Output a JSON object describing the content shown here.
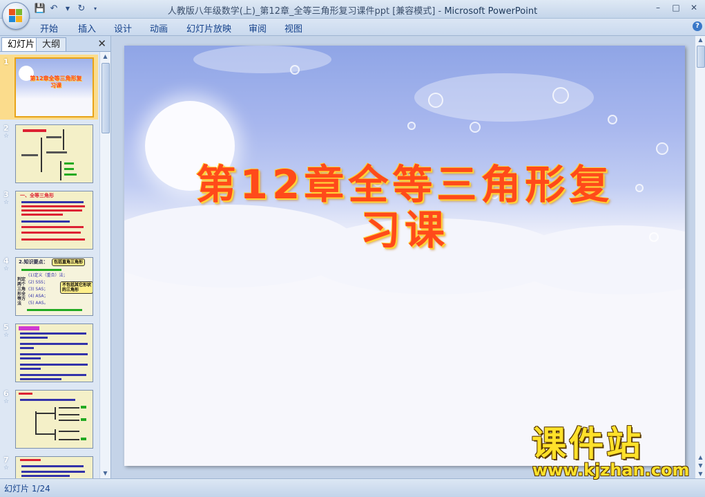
{
  "window": {
    "title": "人教版八年级数学(上)_第12章_全等三角形复习课件ppt [兼容模式]",
    "separator": " - ",
    "app_name": "Microsoft PowerPoint"
  },
  "ribbon": {
    "tabs": [
      "开始",
      "插入",
      "设计",
      "动画",
      "幻灯片放映",
      "审阅",
      "视图"
    ]
  },
  "left_pane": {
    "tabs": [
      "幻灯片",
      "大纲"
    ],
    "close_symbol": "✕",
    "slides": [
      {
        "num": "1",
        "selected": true,
        "title": "第12章全等三角形复习课"
      },
      {
        "num": "2",
        "selected": false
      },
      {
        "num": "3",
        "selected": false,
        "title": "一、全等三角形"
      },
      {
        "num": "4",
        "selected": false,
        "title": "2.知识要点：",
        "callout1": "包括直角三角形",
        "callout2": "不包括其它形状的三角形",
        "items": [
          "(1)定义（重合）法；",
          "(2) SSS；",
          "(3) SAS；",
          "(4) ASA；",
          "(5) AAS。"
        ],
        "side": "判定两个三角形全等方法"
      },
      {
        "num": "5",
        "selected": false
      },
      {
        "num": "6",
        "selected": false
      },
      {
        "num": "7",
        "selected": false
      }
    ]
  },
  "slide": {
    "title": "第12章全等三角形复习课"
  },
  "status": {
    "slide_info": "幻灯片 1/24"
  },
  "watermark": {
    "brand": "课件站",
    "url": "www.kjzhan.com"
  },
  "colors": {
    "title_red": "#ff4a1a",
    "title_outline": "#ffd23a",
    "watermark_yellow": "#ffe12a",
    "selected_slide": "#fbdc8c"
  }
}
